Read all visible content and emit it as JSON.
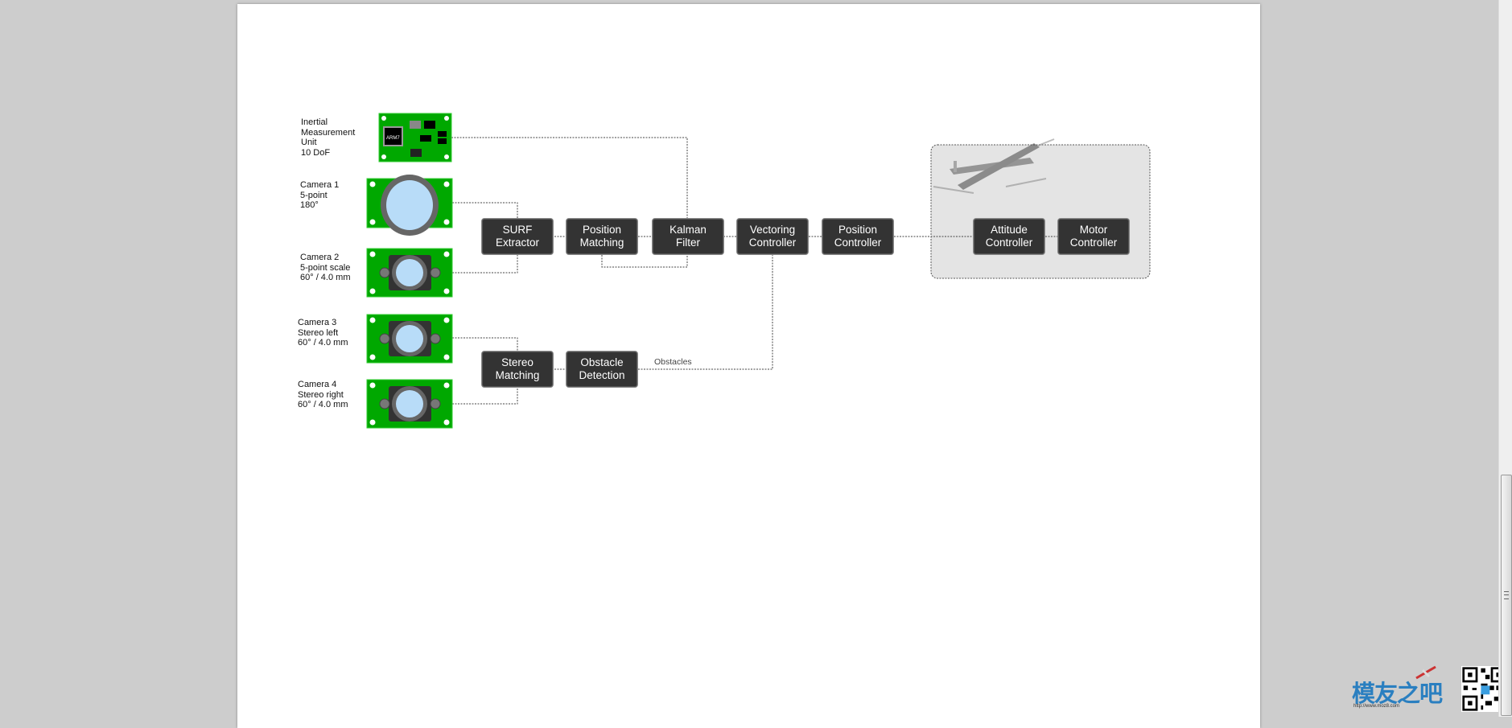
{
  "sensors": [
    {
      "label": "Inertial\nMeasurement\nUnit\n10 DoF",
      "type": "imu",
      "chips": [
        "ARM7"
      ]
    },
    {
      "label": "Camera 1\n5-point\n180°",
      "type": "camera-wide"
    },
    {
      "label": "Camera 2\n5-point scale\n60° / 4.0 mm",
      "type": "camera"
    },
    {
      "label": "Camera 3\nStereo left\n60° / 4.0 mm",
      "type": "camera"
    },
    {
      "label": "Camera 4\nStereo right\n60° / 4.0 mm",
      "type": "camera"
    }
  ],
  "blocks": {
    "surf": "SURF\nExtractor",
    "position_matching": "Position\nMatching",
    "kalman": "Kalman\nFilter",
    "vectoring": "Vectoring\nController",
    "position_controller": "Position\nController",
    "attitude": "Attitude\nController",
    "motor": "Motor\nController",
    "stereo": "Stereo\nMatching",
    "obstacle": "Obstacle\nDetection"
  },
  "edge_labels": {
    "obstacles": "Obstacles"
  },
  "watermark": {
    "text": "模友之吧",
    "url": "http://www.moz8.com"
  },
  "colors": {
    "block": "#333333",
    "board": "#00a800",
    "group": "#e4e4e4",
    "lens": "#a8d4f5"
  }
}
